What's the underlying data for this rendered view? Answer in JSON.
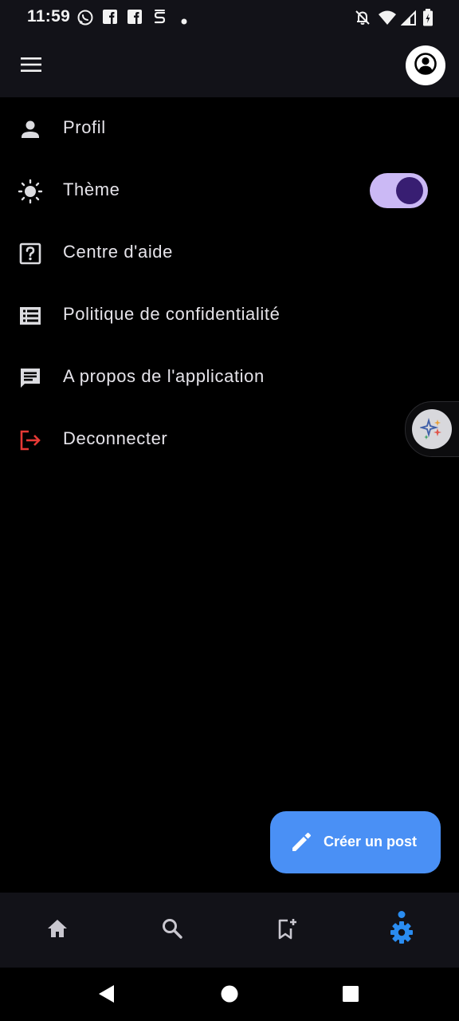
{
  "status_bar": {
    "time": "11:59",
    "left_icons": [
      "whatsapp-icon",
      "facebook-icon",
      "facebook-icon",
      "sync-icon",
      "dot-icon"
    ],
    "right_icons": [
      "notifications-off-icon",
      "wifi-icon",
      "signal-icon",
      "battery-icon"
    ]
  },
  "app_bar": {
    "menu_icon": "hamburger-menu-icon",
    "avatar_icon": "account-circle-icon"
  },
  "settings": {
    "items": [
      {
        "label": "Profil",
        "icon": "person-icon"
      },
      {
        "label": "Thème",
        "icon": "sun-icon",
        "toggle_on": true
      },
      {
        "label": "Centre d'aide",
        "icon": "help-icon"
      },
      {
        "label": "Politique de confidentialité",
        "icon": "list-icon"
      },
      {
        "label": "A propos de l'application",
        "icon": "chat-icon"
      },
      {
        "label": "Deconnecter",
        "icon": "logout-icon"
      }
    ]
  },
  "fab": {
    "label": "Créer un post",
    "icon": "pencil-icon"
  },
  "bottom_nav": {
    "items": [
      "home-icon",
      "search-icon",
      "bookmark-add-icon",
      "settings-icon"
    ],
    "active_index": 3
  },
  "colors": {
    "background": "#000000",
    "bar": "#121218",
    "accent": "#4a90f5",
    "toggle_track": "#cbb9f5",
    "toggle_knob": "#381e72",
    "logout_red": "#e53935"
  }
}
